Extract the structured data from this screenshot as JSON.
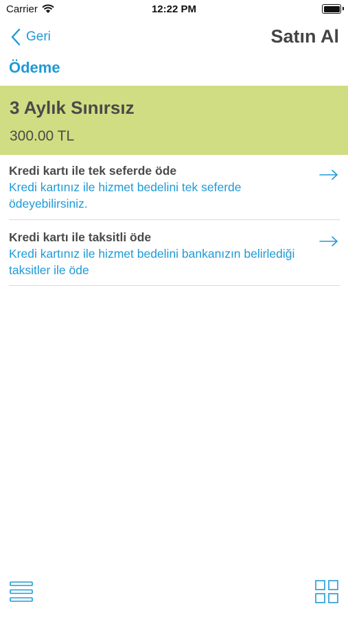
{
  "status_bar": {
    "carrier": "Carrier",
    "time": "12:22 PM"
  },
  "nav": {
    "back_label": "Geri",
    "title": "Satın Al"
  },
  "section_title": "Ödeme",
  "plan": {
    "name": "3 Aylık Sınırsız",
    "price": "300.00 TL"
  },
  "options": [
    {
      "title": "Kredi kartı ile tek seferde öde",
      "description": "Kredi kartınız ile hizmet bedelini tek seferde ödeyebilirsiniz."
    },
    {
      "title": "Kredi kartı ile taksitli öde",
      "description": "Kredi kartınız ile hizmet bedelini bankanızın belirlediği taksitler ile öde"
    }
  ],
  "colors": {
    "accent": "#1e9ad6",
    "plan_background": "#d0dd82",
    "text": "#4a4a4a"
  },
  "icons": {
    "back": "chevron-left-icon",
    "option_arrow": "arrow-right-icon",
    "bottom_left": "menu-icon",
    "bottom_right": "grid-icon"
  }
}
